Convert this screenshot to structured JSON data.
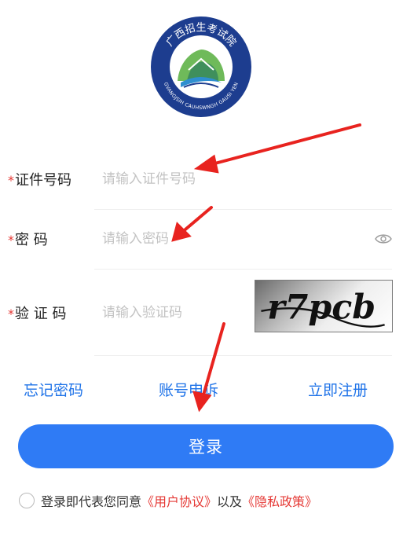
{
  "logo": {
    "arc_text_top": "广西招生考试院",
    "arc_text_bottom": "GVANGJSIH CAUHSWNGH GAUSI YEN",
    "brand_color": "#1d3d8f"
  },
  "form": {
    "id_field": {
      "required_mark": "*",
      "label": "证件号码",
      "placeholder": "请输入证件号码"
    },
    "password_field": {
      "required_mark": "*",
      "label": "密 码",
      "placeholder": "请输入密码"
    },
    "captcha_field": {
      "required_mark": "*",
      "label": "验 证 码",
      "placeholder": "请输入验证码",
      "captcha_text": "r7pcb"
    }
  },
  "links": {
    "forgot": "忘记密码",
    "appeal": "账号申诉",
    "register": "立即注册"
  },
  "login_button": "登录",
  "agreement": {
    "prefix": "登录即代表您同意",
    "user_agreement": "《用户协议》",
    "connector": "以及",
    "privacy_policy": "《隐私政策》"
  },
  "colors": {
    "accent": "#2f7bf5",
    "link": "#1f73e8",
    "required": "#e53935",
    "annotation_arrow": "#e8231f"
  }
}
